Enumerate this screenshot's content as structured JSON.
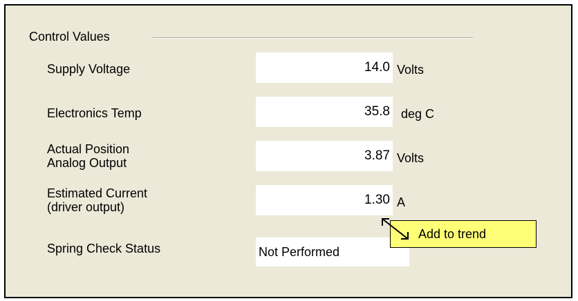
{
  "group": {
    "title": "Control Values"
  },
  "fields": [
    {
      "label_line1": "Supply Voltage",
      "label_line2": "",
      "value": "14.0",
      "unit": "Volts"
    },
    {
      "label_line1": "Electronics Temp",
      "label_line2": "",
      "value": "35.8",
      "unit": "deg C"
    },
    {
      "label_line1": "Actual Position",
      "label_line2": "Analog Output",
      "value": "3.87",
      "unit": "Volts"
    },
    {
      "label_line1": "Estimated Current",
      "label_line2": "(driver output)",
      "value": "1.30",
      "unit": "A"
    }
  ],
  "spring_check": {
    "label": "Spring Check Status",
    "value": "Not Performed"
  },
  "tooltip": {
    "text": "Add to trend"
  },
  "colors": {
    "panel_background": "#ece9d8",
    "tooltip_background": "#ffff77",
    "field_background": "#ffffff"
  },
  "icons": {
    "cursor": "resize-diagonal-cursor-icon"
  }
}
